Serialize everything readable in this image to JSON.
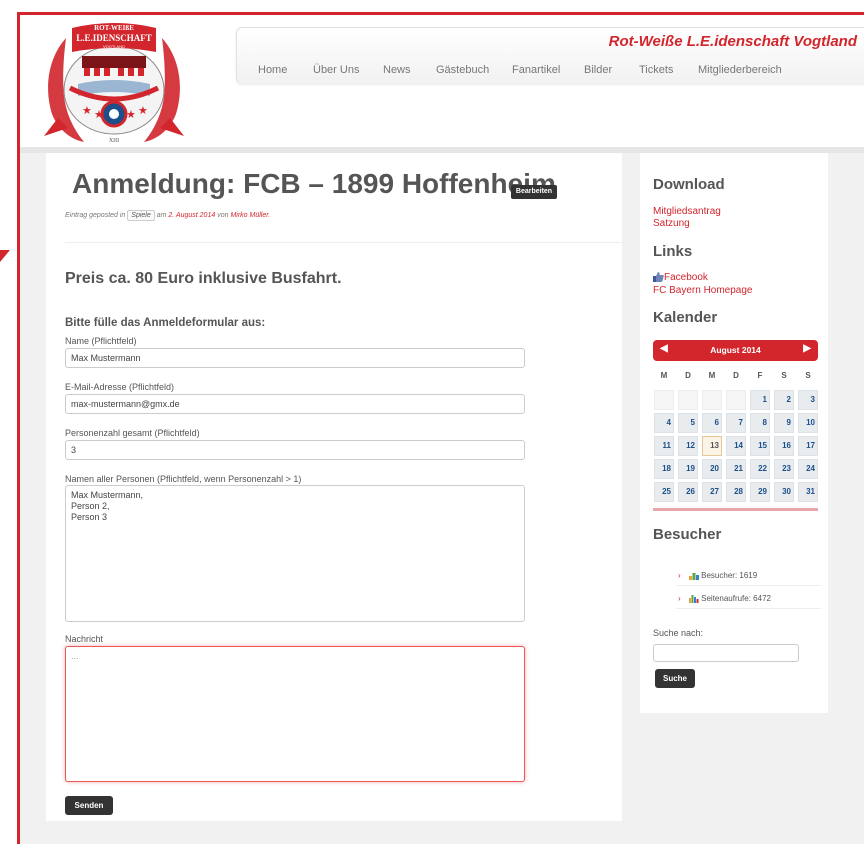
{
  "logo": {
    "line1": "ROT-WEIßE",
    "line2": "L.E.IDENSCHAFT",
    "line3": "VOGTLAND",
    "numeral": "XIII"
  },
  "header": {
    "site_title": "Rot-Weiße L.E.idenschaft Vogtland",
    "nav": [
      "Home",
      "Über Uns",
      "News",
      "Gästebuch",
      "Fanartikel",
      "Bilder",
      "Tickets",
      "Mitgliederbereich"
    ]
  },
  "post": {
    "title": "Anmeldung: FCB – 1899 Hoffenheim",
    "edit_label": "Bearbeiten",
    "meta_prefix": "Eintrag geposted in",
    "category": "Spiele",
    "meta_on": "am",
    "date": "2. August 2014",
    "meta_by": "von",
    "author": "Mirko Müller.",
    "price_text": "Preis ca. 80 Euro inklusive Busfahrt."
  },
  "form": {
    "heading": "Bitte fülle das Anmeldeformular aus:",
    "name_label": "Name (Pflichtfeld)",
    "name_value": "Max Mustermann",
    "email_label": "E-Mail-Adresse (Pflichtfeld)",
    "email_value": "max-mustermann@gmx.de",
    "count_label": "Personenzahl gesamt (Pflichtfeld)",
    "count_value": "3",
    "names_label": "Namen aller Personen (Pflichtfeld, wenn Personenzahl > 1)",
    "names_value": "Max Mustermann,\nPerson 2,\nPerson 3",
    "message_label": "Nachricht",
    "message_value": "...",
    "submit_label": "Senden"
  },
  "sidebar": {
    "download_heading": "Download",
    "downloads": [
      "Mitgliedsantrag",
      "Satzung"
    ],
    "links_heading": "Links",
    "links": [
      "Facebook",
      "FC Bayern Homepage"
    ],
    "calendar_heading": "Kalender",
    "calendar": {
      "month_label": "August 2014",
      "prev": "◀",
      "next": "▶",
      "weekdays": [
        "M",
        "D",
        "M",
        "D",
        "F",
        "S",
        "S"
      ],
      "weeks": [
        [
          "",
          "",
          "",
          "",
          "1",
          "2",
          "3"
        ],
        [
          "4",
          "5",
          "6",
          "7",
          "8",
          "9",
          "10"
        ],
        [
          "11",
          "12",
          "13",
          "14",
          "15",
          "16",
          "17"
        ],
        [
          "18",
          "19",
          "20",
          "21",
          "22",
          "23",
          "24"
        ],
        [
          "25",
          "26",
          "27",
          "28",
          "29",
          "30",
          "31"
        ]
      ],
      "today": "13"
    },
    "visitors_heading": "Besucher",
    "visitors_label": "Besucher: 1619",
    "pageviews_label": "Seitenaufrufe: 6472",
    "search_label": "Suche nach:",
    "search_value": "",
    "search_button": "Suche"
  },
  "colors": {
    "accent": "#d2252c",
    "dark_button": "#333333",
    "calendar_day": "#1d4f8a"
  }
}
